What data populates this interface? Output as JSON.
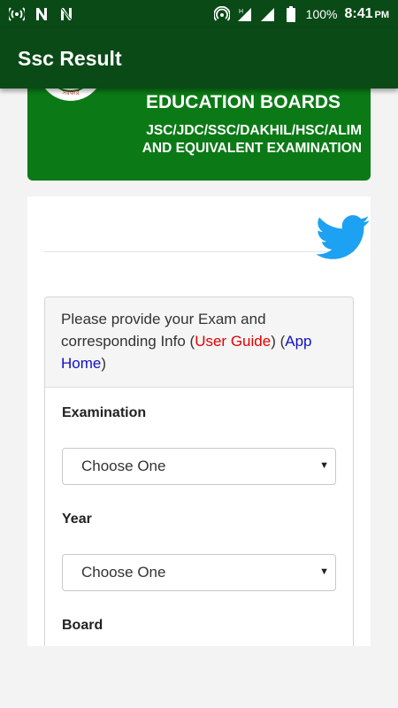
{
  "status_bar": {
    "battery": "100%",
    "time": "8:41",
    "ampm": "PM",
    "icons": [
      "broadcast-icon",
      "n-icon",
      "n-icon",
      "hotspot-icon",
      "signal-h-icon",
      "signal-icon",
      "battery-icon"
    ]
  },
  "appbar": {
    "title": "Ssc Result"
  },
  "banner": {
    "seal_text": "সরকার",
    "title": "EDUCATION BOARDS",
    "subtitle_line1": "JSC/JDC/SSC/DAKHIL/HSC/ALIM",
    "subtitle_line2": "AND EQUIVALENT EXAMINATION"
  },
  "form": {
    "intro_text": "Please provide your Exam and corresponding Info (",
    "user_guide": "User Guide",
    "between": ") (",
    "app_home": "App Home",
    "end": ")",
    "fields": [
      {
        "label": "Examination",
        "value": "Choose One"
      },
      {
        "label": "Year",
        "value": "Choose One"
      },
      {
        "label": "Board",
        "value": ""
      }
    ]
  },
  "colors": {
    "primary_dark": "#0a4a17",
    "banner_green": "#0b7a16",
    "twitter_blue": "#1da1f2",
    "link_red": "#e30000",
    "link_blue": "#1010c8"
  }
}
